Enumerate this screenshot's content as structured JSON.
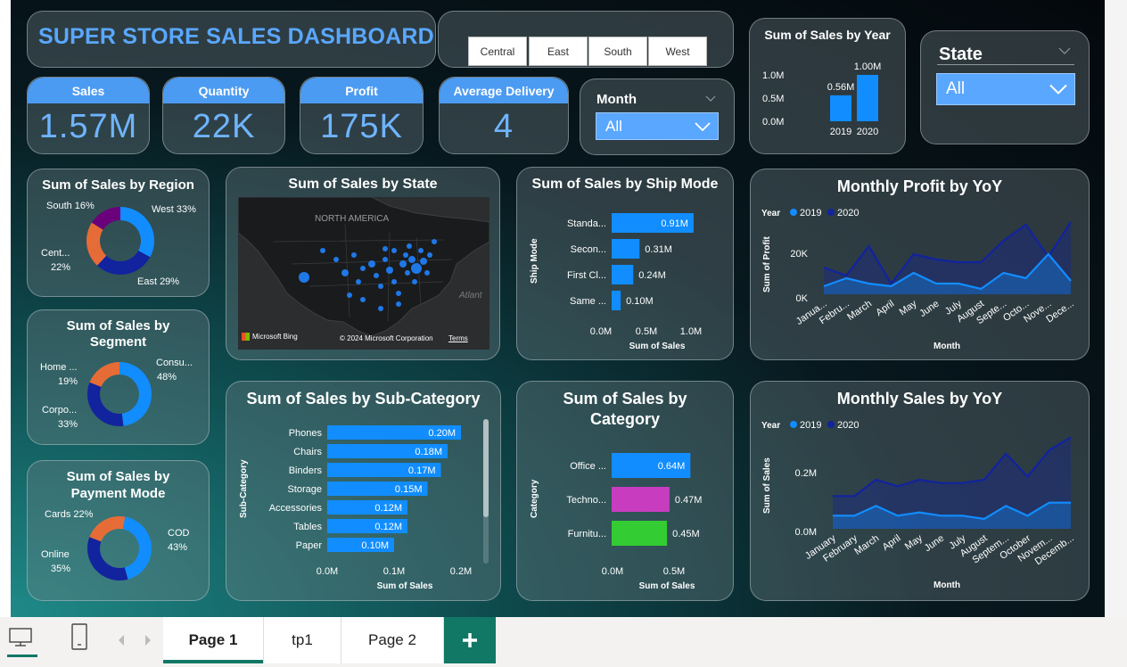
{
  "dashboard": {
    "title": "SUPER STORE SALES DASHBOARD"
  },
  "region_buttons": [
    "Central",
    "East",
    "South",
    "West"
  ],
  "kpis": {
    "sales": {
      "label": "Sales",
      "value": "1.57M"
    },
    "quantity": {
      "label": "Quantity",
      "value": "22K"
    },
    "profit": {
      "label": "Profit",
      "value": "175K"
    },
    "delivery": {
      "label": "Average Delivery",
      "value": "4"
    }
  },
  "month_slicer": {
    "label": "Month",
    "value": "All"
  },
  "state_slicer": {
    "label": "State",
    "value": "All"
  },
  "year_chart": {
    "title": "Sum of Sales by Year",
    "yticks": [
      "1.0M",
      "0.5M",
      "0.0M"
    ],
    "categories": [
      "2019",
      "2020"
    ],
    "labels": [
      "0.56M",
      "1.00M"
    ]
  },
  "region_chart": {
    "title": "Sum of Sales by Region",
    "labels": [
      "South 16%",
      "West 33%",
      "Cent...",
      "22%",
      "East 29%"
    ]
  },
  "segment_chart": {
    "title_line1": "Sum of Sales by",
    "title_line2": "Segment",
    "labels": [
      "Home ...",
      "19%",
      "Consu...",
      "48%",
      "Corpo...",
      "33%"
    ]
  },
  "payment_chart": {
    "title_line1": "Sum of Sales by",
    "title_line2": "Payment Mode",
    "labels": [
      "Cards 22%",
      "COD",
      "43%",
      "Online",
      "35%"
    ]
  },
  "map": {
    "title": "Sum of Sales by State",
    "region_label": "NORTH AMERICA",
    "ocean_label": "Atlant",
    "bing": "Microsoft Bing",
    "copyright": "© 2024 Microsoft Corporation",
    "terms": "Terms"
  },
  "shipmode_chart": {
    "title": "Sum of Sales by Ship Mode",
    "ylabel": "Ship Mode",
    "xlabel": "Sum of Sales",
    "xticks": [
      "0.0M",
      "0.5M",
      "1.0M"
    ],
    "categories": [
      "Standa...",
      "Secon...",
      "First Cl...",
      "Same ..."
    ],
    "labels": [
      "0.91M",
      "0.31M",
      "0.24M",
      "0.10M"
    ]
  },
  "subcat_chart": {
    "title": "Sum of Sales by Sub-Category",
    "ylabel": "Sub-Category",
    "xlabel": "Sum of Sales",
    "xticks": [
      "0.0M",
      "0.1M",
      "0.2M"
    ],
    "categories": [
      "Phones",
      "Chairs",
      "Binders",
      "Storage",
      "Accessories",
      "Tables",
      "Paper"
    ],
    "labels": [
      "0.20M",
      "0.18M",
      "0.17M",
      "0.15M",
      "0.12M",
      "0.12M",
      "0.10M"
    ]
  },
  "category_chart": {
    "title_line1": "Sum of Sales by",
    "title_line2": "Category",
    "ylabel": "Category",
    "xlabel": "Sum of Sales",
    "xticks": [
      "0.0M",
      "0.5M"
    ],
    "categories": [
      "Office ...",
      "Techno...",
      "Furnitu..."
    ],
    "labels": [
      "0.64M",
      "0.47M",
      "0.45M"
    ]
  },
  "profit_chart": {
    "title": "Monthly Profit by YoY",
    "legend_title": "Year",
    "legend": [
      "2019",
      "2020"
    ],
    "yticks": [
      "20K",
      "0K"
    ],
    "ylabel": "Sum of Profit",
    "xlabel": "Month",
    "xticks": [
      "Janua...",
      "Febru...",
      "March",
      "April",
      "May",
      "June",
      "July",
      "August",
      "Septe...",
      "Octo...",
      "Nove...",
      "Dece..."
    ]
  },
  "sales_chart": {
    "title": "Monthly Sales by YoY",
    "legend_title": "Year",
    "legend": [
      "2019",
      "2020"
    ],
    "yticks": [
      "0.2M",
      "0.0M"
    ],
    "ylabel": "Sum of Sales",
    "xlabel": "Month",
    "xticks": [
      "January",
      "February",
      "March",
      "April",
      "May",
      "June",
      "July",
      "August",
      "Septem...",
      "October",
      "Novem...",
      "Decemb..."
    ]
  },
  "chart_data": [
    {
      "type": "bar",
      "title": "Sum of Sales by Year",
      "categories": [
        "2019",
        "2020"
      ],
      "values": [
        0.56,
        1.0
      ],
      "unit": "M",
      "ylim": [
        0,
        1.0
      ],
      "colors": [
        "#118dff"
      ]
    },
    {
      "type": "pie",
      "title": "Sum of Sales by Region",
      "categories": [
        "West",
        "East",
        "Central",
        "South"
      ],
      "values": [
        33,
        29,
        22,
        16
      ],
      "colors": [
        "#118dff",
        "#12239e",
        "#e66c37",
        "#6b007b"
      ]
    },
    {
      "type": "pie",
      "title": "Sum of Sales by Segment",
      "categories": [
        "Consumer",
        "Corporate",
        "Home Office"
      ],
      "values": [
        48,
        33,
        19
      ],
      "colors": [
        "#118dff",
        "#12239e",
        "#e66c37"
      ]
    },
    {
      "type": "pie",
      "title": "Sum of Sales by Payment Mode",
      "categories": [
        "COD",
        "Online",
        "Cards"
      ],
      "values": [
        43,
        35,
        22
      ],
      "colors": [
        "#118dff",
        "#12239e",
        "#e66c37"
      ]
    },
    {
      "type": "bar",
      "title": "Sum of Sales by Ship Mode",
      "categories": [
        "Standa...",
        "Secon...",
        "First Cl...",
        "Same ..."
      ],
      "values": [
        0.91,
        0.31,
        0.24,
        0.1
      ],
      "unit": "M",
      "xlim": [
        0,
        1.0
      ]
    },
    {
      "type": "bar",
      "title": "Sum of Sales by Sub-Category",
      "categories": [
        "Phones",
        "Chairs",
        "Binders",
        "Storage",
        "Accessories",
        "Tables",
        "Paper"
      ],
      "values": [
        0.2,
        0.18,
        0.17,
        0.15,
        0.12,
        0.12,
        0.1
      ],
      "unit": "M",
      "xlim": [
        0,
        0.2
      ]
    },
    {
      "type": "bar",
      "title": "Sum of Sales by Category",
      "categories": [
        "Office ...",
        "Techno...",
        "Furnitu..."
      ],
      "values": [
        0.64,
        0.47,
        0.45
      ],
      "unit": "M",
      "xlim": [
        0,
        0.5
      ],
      "colors": [
        "#118dff",
        "#c83dc0",
        "#33cc33"
      ]
    },
    {
      "type": "area",
      "title": "Monthly Profit by YoY",
      "ylim": [
        0,
        30
      ],
      "series": [
        {
          "name": "2019",
          "values": [
            3,
            6,
            4,
            3,
            8,
            4,
            4,
            2,
            8,
            6,
            15,
            5
          ],
          "color": "#118dff"
        },
        {
          "name": "2020",
          "values": [
            10,
            7,
            18,
            4,
            15,
            13,
            12,
            12,
            20,
            26,
            14,
            27
          ],
          "color": "#12239e"
        }
      ]
    },
    {
      "type": "area",
      "title": "Monthly Sales by YoY",
      "ylim": [
        0,
        0.3
      ],
      "series": [
        {
          "name": "2019",
          "values": [
            0.04,
            0.04,
            0.07,
            0.04,
            0.05,
            0.04,
            0.04,
            0.03,
            0.07,
            0.04,
            0.08,
            0.08
          ],
          "color": "#118dff"
        },
        {
          "name": "2020",
          "values": [
            0.1,
            0.1,
            0.15,
            0.13,
            0.15,
            0.14,
            0.14,
            0.15,
            0.23,
            0.16,
            0.24,
            0.28
          ],
          "color": "#12239e"
        }
      ]
    }
  ],
  "page_tabs": [
    "Page 1",
    "tp1",
    "Page 2"
  ]
}
